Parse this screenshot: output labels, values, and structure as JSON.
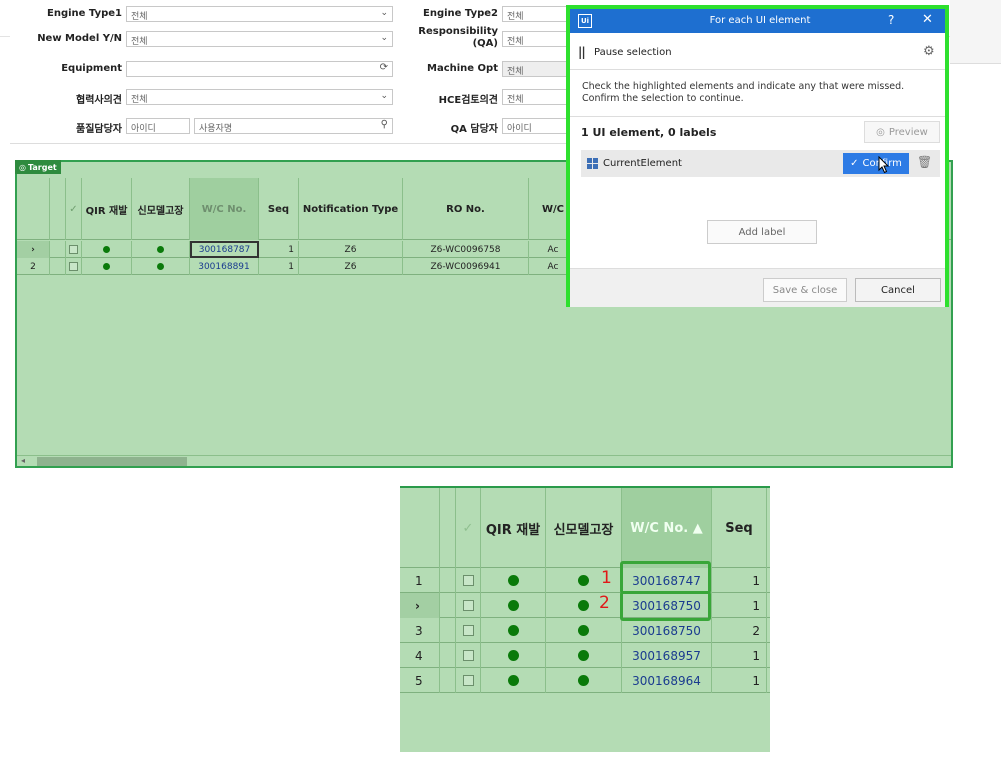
{
  "filters": {
    "engine_type1": {
      "label": "Engine Type1",
      "value": "전체"
    },
    "new_model": {
      "label": "New Model Y/N",
      "value": "전체"
    },
    "equipment": {
      "label": "Equipment",
      "value": ""
    },
    "supplier_opinion": {
      "label": "협력사의견",
      "value": "전체"
    },
    "quality_manager": {
      "label": "품질담당자",
      "id_placeholder": "아이디",
      "name_placeholder": "사용자명"
    },
    "engine_type2": {
      "label": "Engine Type2",
      "value": "전체"
    },
    "responsibility": {
      "label_line1": "Responsibility",
      "label_line2": "(QA)",
      "value": "전체"
    },
    "machine_opt": {
      "label": "Machine Opt",
      "value": "전체"
    },
    "hce_review": {
      "label": "HCE검토의견",
      "value": "전체"
    },
    "qa_manager": {
      "label": "QA 담당자",
      "id_placeholder": "아이디"
    }
  },
  "target_tag": "Target",
  "grid": {
    "headers": {
      "qir": "QIR 재발",
      "new_model": "신모델고장",
      "wc": "W/C No.",
      "seq": "Seq",
      "notif": "Notification Type",
      "ro": "RO No.",
      "wc2": "W/C"
    },
    "rows": [
      {
        "marker": "›",
        "wc": "300168787",
        "seq": "1",
        "notif": "Z6",
        "ro": "Z6-WC0096758",
        "extra": "Ac"
      },
      {
        "marker": "2",
        "wc": "300168891",
        "seq": "1",
        "notif": "Z6",
        "ro": "Z6-WC0096941",
        "extra": "Ac"
      }
    ]
  },
  "dialog": {
    "title": "For each UI element",
    "logo": "Ui",
    "help": "?",
    "close": "✕",
    "pause_label": "Pause selection",
    "instructions": "Check the highlighted elements and indicate any that were missed. Confirm the selection to continue.",
    "count": "1 UI element, 0 labels",
    "preview": "Preview",
    "element_name": "CurrentElement",
    "confirm": "Confirm",
    "add_label": "Add label",
    "save_close": "Save & close",
    "cancel": "Cancel"
  },
  "zoom": {
    "headers": {
      "qir": "QIR 재발",
      "new_model": "신모델고장",
      "wc": "W/C No. ▲",
      "seq": "Seq"
    },
    "rows": [
      {
        "num": "1",
        "wc": "300168747",
        "seq": "1",
        "mark": "1"
      },
      {
        "num": "›",
        "wc": "300168750",
        "seq": "1",
        "mark": "2"
      },
      {
        "num": "3",
        "wc": "300168750",
        "seq": "2",
        "mark": ""
      },
      {
        "num": "4",
        "wc": "300168957",
        "seq": "1",
        "mark": ""
      },
      {
        "num": "5",
        "wc": "300168964",
        "seq": "1",
        "mark": ""
      }
    ]
  },
  "colors": {
    "accent": "#1e6fd0",
    "highlight": "#2ee02e",
    "grid": "#b4dcb4",
    "marker": "#e01818"
  }
}
